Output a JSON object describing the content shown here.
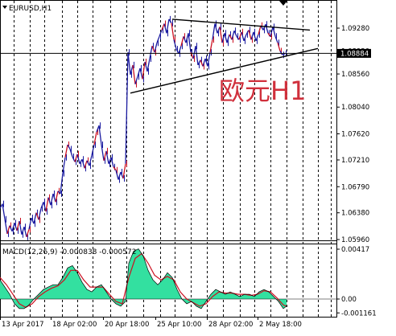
{
  "chart_data": {
    "type": "line",
    "symbol_title": "EURUSD,H1",
    "annotation": "欧元H1",
    "current_price": "1.08884",
    "price_axis_labels": [
      "1.09280",
      "1.08920",
      "1.08560",
      "1.08040",
      "1.07620",
      "1.07210",
      "1.06790",
      "1.06380",
      "1.05960"
    ],
    "price_axis_values": [
      1.0928,
      1.0892,
      1.0856,
      1.0804,
      1.0762,
      1.0721,
      1.0679,
      1.0638,
      1.0596
    ],
    "time_axis_labels": [
      "13 Apr 2017",
      "18 Apr 02:00",
      "20 Apr 18:00",
      "25 Apr 10:00",
      "28 Apr 02:00",
      "2 May 18:00"
    ],
    "price_series": [
      [
        0,
        1.0645
      ],
      [
        3,
        1.0652
      ],
      [
        6,
        1.0628
      ],
      [
        9,
        1.0605
      ],
      [
        12,
        1.0618
      ],
      [
        15,
        1.0609
      ],
      [
        18,
        1.0622
      ],
      [
        21,
        1.061
      ],
      [
        24,
        1.0625
      ],
      [
        27,
        1.0604
      ],
      [
        30,
        1.0616
      ],
      [
        33,
        1.06
      ],
      [
        36,
        1.0612
      ],
      [
        39,
        1.063
      ],
      [
        42,
        1.0621
      ],
      [
        45,
        1.0638
      ],
      [
        48,
        1.0627
      ],
      [
        51,
        1.0645
      ],
      [
        54,
        1.0655
      ],
      [
        57,
        1.064
      ],
      [
        60,
        1.0662
      ],
      [
        63,
        1.065
      ],
      [
        66,
        1.0668
      ],
      [
        69,
        1.0655
      ],
      [
        72,
        1.0672
      ],
      [
        75,
        1.0668
      ],
      [
        78,
        1.07
      ],
      [
        81,
        1.0725
      ],
      [
        84,
        1.0745
      ],
      [
        87,
        1.0738
      ],
      [
        90,
        1.0726
      ],
      [
        93,
        1.0718
      ],
      [
        96,
        1.073
      ],
      [
        99,
        1.0715
      ],
      [
        102,
        1.0722
      ],
      [
        105,
        1.0708
      ],
      [
        108,
        1.072
      ],
      [
        111,
        1.0712
      ],
      [
        114,
        1.0728
      ],
      [
        117,
        1.0745
      ],
      [
        120,
        1.0765
      ],
      [
        123,
        1.0775
      ],
      [
        126,
        1.0745
      ],
      [
        129,
        1.072
      ],
      [
        132,
        1.0735
      ],
      [
        135,
        1.0715
      ],
      [
        138,
        1.0725
      ],
      [
        141,
        1.071
      ],
      [
        144,
        1.0705
      ],
      [
        147,
        1.069
      ],
      [
        150,
        1.0702
      ],
      [
        153,
        1.0692
      ],
      [
        156,
        1.0715
      ],
      [
        159,
        1.089
      ],
      [
        162,
        1.0855
      ],
      [
        165,
        1.087
      ],
      [
        168,
        1.084
      ],
      [
        171,
        1.0852
      ],
      [
        174,
        1.0865
      ],
      [
        177,
        1.0848
      ],
      [
        180,
        1.0875
      ],
      [
        183,
        1.086
      ],
      [
        186,
        1.088
      ],
      [
        189,
        1.09
      ],
      [
        192,
        1.089
      ],
      [
        195,
        1.0905
      ],
      [
        198,
        1.0915
      ],
      [
        201,
        1.0925
      ],
      [
        204,
        1.0935
      ],
      [
        207,
        1.092
      ],
      [
        210,
        1.0942
      ],
      [
        213,
        1.0936
      ],
      [
        216,
        1.091
      ],
      [
        219,
        1.0895
      ],
      [
        222,
        1.0888
      ],
      [
        225,
        1.09
      ],
      [
        228,
        1.0915
      ],
      [
        231,
        1.0905
      ],
      [
        234,
        1.092
      ],
      [
        237,
        1.089
      ],
      [
        240,
        1.088
      ],
      [
        243,
        1.09
      ],
      [
        246,
        1.087
      ],
      [
        249,
        1.0878
      ],
      [
        252,
        1.0868
      ],
      [
        255,
        1.088
      ],
      [
        258,
        1.0868
      ],
      [
        261,
        1.089
      ],
      [
        264,
        1.091
      ],
      [
        267,
        1.0935
      ],
      [
        270,
        1.092
      ],
      [
        273,
        1.093
      ],
      [
        276,
        1.0905
      ],
      [
        279,
        1.092
      ],
      [
        282,
        1.0905
      ],
      [
        285,
        1.0918
      ],
      [
        288,
        1.091
      ],
      [
        291,
        1.0924
      ],
      [
        294,
        1.0915
      ],
      [
        297,
        1.091
      ],
      [
        300,
        1.0922
      ],
      [
        303,
        1.0908
      ],
      [
        306,
        1.0918
      ],
      [
        309,
        1.0925
      ],
      [
        312,
        1.091
      ],
      [
        315,
        1.0922
      ],
      [
        318,
        1.0908
      ],
      [
        321,
        1.0918
      ],
      [
        324,
        1.0932
      ],
      [
        327,
        1.0925
      ],
      [
        330,
        1.0934
      ],
      [
        333,
        1.092
      ],
      [
        336,
        1.0915
      ],
      [
        339,
        1.093
      ],
      [
        342,
        1.0915
      ],
      [
        345,
        1.0905
      ],
      [
        348,
        1.0892
      ],
      [
        351,
        1.0886
      ],
      [
        354,
        1.0888
      ]
    ],
    "trendlines": [
      {
        "points": [
          [
            214,
            1.0942
          ],
          [
            385,
            1.0925
          ]
        ]
      },
      {
        "points": [
          [
            162,
            1.0826
          ],
          [
            395,
            1.0896
          ]
        ]
      }
    ],
    "macd": {
      "label": "MACD(12,26,9) -0.000838 -0.000572",
      "axis_labels": [
        "0.00417",
        "0.00",
        "-0.001161"
      ],
      "axis_values": [
        0.00417,
        0.0,
        -0.001161
      ],
      "histogram": [
        [
          0,
          0.0016
        ],
        [
          6,
          0.001
        ],
        [
          12,
          0.0004
        ],
        [
          18,
          -0.0004
        ],
        [
          24,
          -0.0008
        ],
        [
          30,
          -0.0008
        ],
        [
          36,
          -0.0005
        ],
        [
          42,
          0.0
        ],
        [
          48,
          0.0004
        ],
        [
          54,
          0.0008
        ],
        [
          60,
          0.001
        ],
        [
          66,
          0.0012
        ],
        [
          72,
          0.0012
        ],
        [
          78,
          0.0018
        ],
        [
          84,
          0.0026
        ],
        [
          90,
          0.0028
        ],
        [
          96,
          0.0022
        ],
        [
          102,
          0.0014
        ],
        [
          108,
          0.0008
        ],
        [
          114,
          0.0006
        ],
        [
          120,
          0.001
        ],
        [
          126,
          0.0012
        ],
        [
          132,
          0.0006
        ],
        [
          138,
          0.0
        ],
        [
          144,
          -0.0004
        ],
        [
          150,
          -0.0006
        ],
        [
          156,
          -0.0002
        ],
        [
          160,
          0.003
        ],
        [
          166,
          0.004
        ],
        [
          172,
          0.0042
        ],
        [
          178,
          0.0036
        ],
        [
          184,
          0.0024
        ],
        [
          190,
          0.0016
        ],
        [
          196,
          0.0012
        ],
        [
          202,
          0.0016
        ],
        [
          208,
          0.0022
        ],
        [
          214,
          0.0018
        ],
        [
          220,
          0.0008
        ],
        [
          226,
          0.0
        ],
        [
          232,
          -0.0004
        ],
        [
          238,
          -0.0002
        ],
        [
          244,
          -0.0006
        ],
        [
          250,
          -0.0008
        ],
        [
          256,
          -0.0002
        ],
        [
          262,
          0.0004
        ],
        [
          268,
          0.0008
        ],
        [
          274,
          0.0006
        ],
        [
          280,
          0.0004
        ],
        [
          286,
          0.0006
        ],
        [
          292,
          0.0004
        ],
        [
          298,
          0.0002
        ],
        [
          304,
          0.0004
        ],
        [
          310,
          0.0004
        ],
        [
          316,
          0.0002
        ],
        [
          322,
          0.0006
        ],
        [
          328,
          0.0008
        ],
        [
          334,
          0.0006
        ],
        [
          340,
          0.0002
        ],
        [
          346,
          -0.0002
        ],
        [
          352,
          -0.0008
        ],
        [
          356,
          -0.0006
        ]
      ],
      "signal": [
        [
          0,
          0.0018
        ],
        [
          8,
          0.0012
        ],
        [
          16,
          0.0004
        ],
        [
          24,
          -0.0004
        ],
        [
          32,
          -0.0007
        ],
        [
          40,
          -0.0004
        ],
        [
          48,
          0.0002
        ],
        [
          56,
          0.0006
        ],
        [
          64,
          0.0009
        ],
        [
          72,
          0.0011
        ],
        [
          80,
          0.0016
        ],
        [
          88,
          0.0024
        ],
        [
          96,
          0.0024
        ],
        [
          104,
          0.0016
        ],
        [
          112,
          0.001
        ],
        [
          120,
          0.001
        ],
        [
          128,
          0.001
        ],
        [
          136,
          0.0004
        ],
        [
          144,
          -0.0002
        ],
        [
          152,
          -0.0004
        ],
        [
          160,
          0.0018
        ],
        [
          168,
          0.0034
        ],
        [
          176,
          0.0038
        ],
        [
          184,
          0.003
        ],
        [
          192,
          0.002
        ],
        [
          200,
          0.0016
        ],
        [
          208,
          0.0019
        ],
        [
          216,
          0.0016
        ],
        [
          224,
          0.0006
        ],
        [
          232,
          0.0
        ],
        [
          240,
          -0.0003
        ],
        [
          248,
          -0.0006
        ],
        [
          256,
          -0.0004
        ],
        [
          264,
          0.0002
        ],
        [
          272,
          0.0006
        ],
        [
          280,
          0.0005
        ],
        [
          288,
          0.0005
        ],
        [
          296,
          0.0004
        ],
        [
          304,
          0.0004
        ],
        [
          312,
          0.0003
        ],
        [
          320,
          0.0004
        ],
        [
          328,
          0.0007
        ],
        [
          336,
          0.0006
        ],
        [
          344,
          0.0001
        ],
        [
          352,
          -0.0005
        ],
        [
          356,
          -0.0006
        ]
      ]
    },
    "colors": {
      "price_line": "#1a1aa0",
      "price_line_alt": "#cc1020",
      "trendline": "#000000",
      "macd_histogram": "#33e0a0",
      "macd_signal": "#cc1020",
      "price_box": "#000000",
      "annotation": "#d0303c"
    },
    "grid": "vertical dashed"
  }
}
